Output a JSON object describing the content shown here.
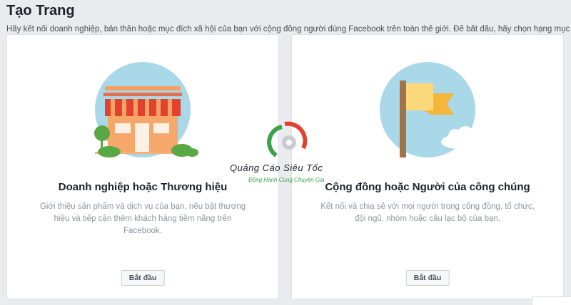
{
  "header": {
    "title": "Tạo Trang",
    "subtitle": "Hãy kết nối doanh nghiệp, bản thân hoặc mục đích xã hội của bạn với cộng đồng người dùng Facebook trên toàn thế giới. Để bắt đầu, hãy chọn hạng mục"
  },
  "cards": [
    {
      "title": "Doanh nghiệp hoặc Thương hiệu",
      "description": "Giới thiệu sản phẩm và dịch vụ của bạn, nêu bật thương hiệu và tiếp cận thêm khách hàng tiềm năng trên Facebook.",
      "button_label": "Bắt đầu",
      "icon": "storefront-icon"
    },
    {
      "title": "Cộng đồng hoặc Người của công chúng",
      "description": "Kết nối và chia sẻ với mọi người trong cộng đồng, tổ chức, đội ngũ, nhóm hoặc câu lạc bộ của bạn.",
      "button_label": "Bắt đầu",
      "icon": "flag-icon"
    }
  ],
  "watermark": {
    "name": "Quảng Cáo Siêu Tốc",
    "slogan": "Đồng Hành Cùng Chuyên Gia"
  },
  "colors": {
    "background": "#e9ebee",
    "illustration_circle": "#a9d8e8",
    "awning_red": "#e1412f",
    "store_orange": "#f6a86a",
    "flag_yellow": "#f7c948",
    "brand_green": "#3aa34a"
  }
}
